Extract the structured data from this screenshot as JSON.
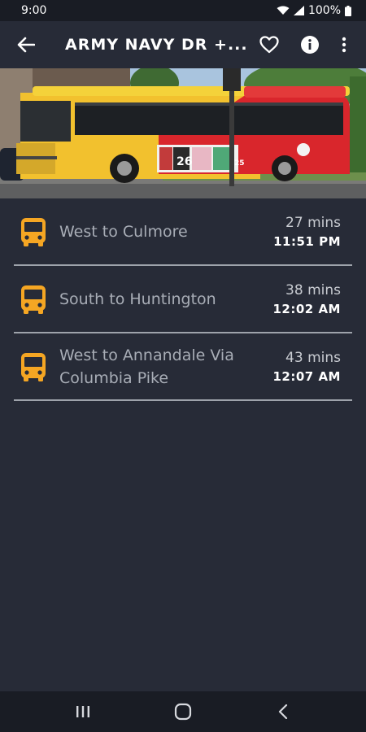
{
  "status_bar": {
    "time": "9:00",
    "battery": "100%",
    "icons": [
      "wifi-icon",
      "signal-icon",
      "battery-icon"
    ]
  },
  "app_bar": {
    "title": "ARMY NAVY DR +...",
    "icons": [
      "back-arrow-icon",
      "heart-icon",
      "info-icon",
      "more-vert-icon"
    ]
  },
  "hero": {
    "description_icons": [
      "bus-photo"
    ],
    "bus_signs": [
      "26",
      "25"
    ]
  },
  "arrivals": [
    {
      "route": "West to Culmore",
      "mins": "27 mins",
      "time": "11:51 PM"
    },
    {
      "route": "South to Huntington",
      "mins": "38 mins",
      "time": "12:02 AM"
    },
    {
      "route": "West to Annandale Via Columbia Pike",
      "mins": "43 mins",
      "time": "12:07 AM"
    }
  ],
  "colors": {
    "background": "#272b37",
    "bus_icon": "#f5a623",
    "divider": "#9ea3ab"
  },
  "nav_bar": {
    "icons": [
      "recents-icon",
      "home-icon",
      "back-icon"
    ]
  }
}
